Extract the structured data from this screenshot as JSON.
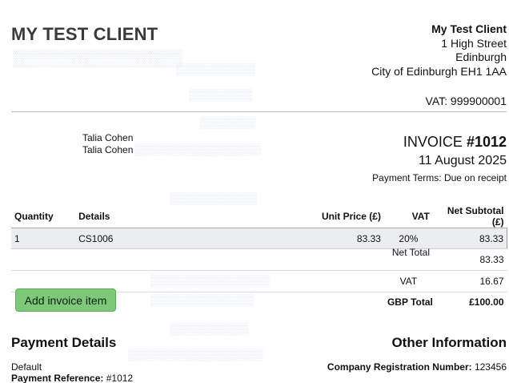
{
  "client": {
    "title": "MY TEST CLIENT"
  },
  "company": {
    "name": "My Test Client",
    "address1": "1 High Street",
    "city": "Edinburgh",
    "region_postcode": "City of Edinburgh EH1 1AA",
    "vat": "VAT: 999900001"
  },
  "recipient": {
    "line1": "Talia Cohen",
    "line2": "Talia Cohen"
  },
  "invoice": {
    "label": "INVOICE ",
    "number": "#1012",
    "date": "11 August 2025",
    "terms": "Payment Terms: Due on receipt"
  },
  "table": {
    "headers": {
      "quantity": "Quantity",
      "details": "Details",
      "unit_price": "Unit Price (£)",
      "vat": "VAT",
      "net_subtotal": "Net Subtotal (£)"
    },
    "rows": [
      {
        "quantity": "1",
        "details": "CS1006",
        "unit_price": "83.33",
        "vat": "20%",
        "net_subtotal": "83.33"
      }
    ],
    "net_total_label": "Net Total",
    "net_total": "83.33",
    "vat_label": "VAT",
    "vat_total": "16.67",
    "gbp_total_label": "GBP Total",
    "gbp_total": "£100.00"
  },
  "actions": {
    "add_item": "Add invoice item"
  },
  "payment": {
    "title": "Payment Details",
    "method": "Default",
    "reference_label": "Payment Reference:",
    "reference": "#1012"
  },
  "other": {
    "title": "Other Information",
    "registration_label": "Company Registration Number:",
    "registration": "123456"
  },
  "colors": {
    "button_bg": "#7ec87a",
    "row_bg": "#ebedf0",
    "title": "#3a3a3a"
  }
}
